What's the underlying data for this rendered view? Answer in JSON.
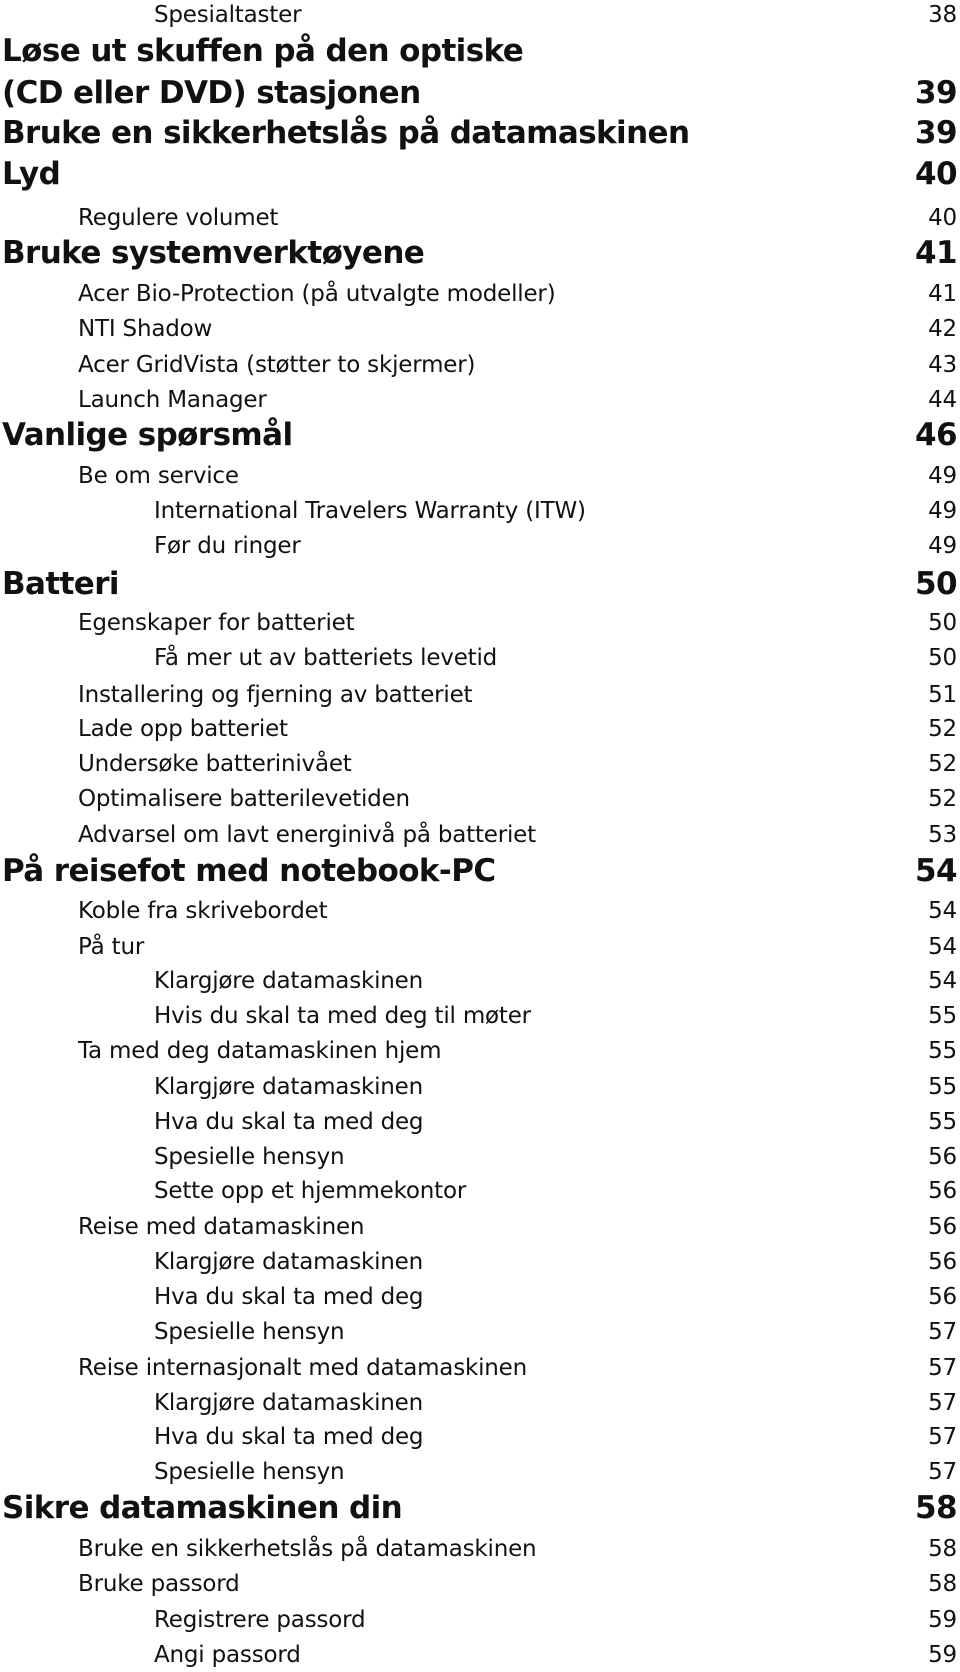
{
  "document": {
    "type": "table-of-contents",
    "entries": [
      {
        "level": 2,
        "title": "Spesialtaster",
        "page": "38"
      },
      {
        "level": 0,
        "title": "Løse ut skuffen på den optiske",
        "page": ""
      },
      {
        "level": 0,
        "title": "(CD eller DVD) stasjonen",
        "page": "39"
      },
      {
        "level": 0,
        "title": "Bruke en sikkerhetslås på datamaskinen",
        "page": "39"
      },
      {
        "level": 0,
        "title": "Lyd",
        "page": "40"
      },
      {
        "level": 1,
        "title": "Regulere volumet",
        "page": "40"
      },
      {
        "level": 0,
        "title": "Bruke systemverktøyene",
        "page": "41"
      },
      {
        "level": 1,
        "title": "Acer Bio-Protection (på utvalgte modeller)",
        "page": "41"
      },
      {
        "level": 1,
        "title": "NTI Shadow",
        "page": "42"
      },
      {
        "level": 1,
        "title": "Acer GridVista (støtter to skjermer)",
        "page": "43"
      },
      {
        "level": 1,
        "title": "Launch Manager",
        "page": "44"
      },
      {
        "level": 0,
        "title": "Vanlige spørsmål",
        "page": "46"
      },
      {
        "level": 1,
        "title": "Be om service",
        "page": "49"
      },
      {
        "level": 2,
        "title": "International Travelers Warranty (ITW)",
        "page": "49"
      },
      {
        "level": 2,
        "title": "Før du ringer",
        "page": "49"
      },
      {
        "level": 0,
        "title": "Batteri",
        "page": "50"
      },
      {
        "level": 1,
        "title": "Egenskaper for batteriet",
        "page": "50"
      },
      {
        "level": 2,
        "title": "Få mer ut av batteriets levetid",
        "page": "50"
      },
      {
        "level": 1,
        "title": "Installering og fjerning av batteriet",
        "page": "51"
      },
      {
        "level": 1,
        "title": "Lade opp batteriet",
        "page": "52"
      },
      {
        "level": 1,
        "title": "Undersøke batterinivået",
        "page": "52"
      },
      {
        "level": 1,
        "title": "Optimalisere batterilevetiden",
        "page": "52"
      },
      {
        "level": 1,
        "title": "Advarsel om lavt energinivå på batteriet",
        "page": "53"
      },
      {
        "level": 0,
        "title": "På reisefot med notebook-PC",
        "page": "54"
      },
      {
        "level": 1,
        "title": "Koble fra skrivebordet",
        "page": "54"
      },
      {
        "level": 1,
        "title": "På tur",
        "page": "54"
      },
      {
        "level": 2,
        "title": "Klargjøre datamaskinen",
        "page": "54"
      },
      {
        "level": 2,
        "title": "Hvis du skal ta med deg til møter",
        "page": "55"
      },
      {
        "level": 1,
        "title": "Ta med deg datamaskinen hjem",
        "page": "55"
      },
      {
        "level": 2,
        "title": "Klargjøre datamaskinen",
        "page": "55"
      },
      {
        "level": 2,
        "title": "Hva du skal ta med deg",
        "page": "55"
      },
      {
        "level": 2,
        "title": "Spesielle hensyn",
        "page": "56"
      },
      {
        "level": 2,
        "title": "Sette opp et hjemmekontor",
        "page": "56"
      },
      {
        "level": 1,
        "title": "Reise med datamaskinen",
        "page": "56"
      },
      {
        "level": 2,
        "title": "Klargjøre datamaskinen",
        "page": "56"
      },
      {
        "level": 2,
        "title": "Hva du skal ta med deg",
        "page": "56"
      },
      {
        "level": 2,
        "title": "Spesielle hensyn",
        "page": "57"
      },
      {
        "level": 1,
        "title": "Reise internasjonalt med datamaskinen",
        "page": "57"
      },
      {
        "level": 2,
        "title": "Klargjøre datamaskinen",
        "page": "57"
      },
      {
        "level": 2,
        "title": "Hva du skal ta med deg",
        "page": "57"
      },
      {
        "level": 2,
        "title": "Spesielle hensyn",
        "page": "57"
      },
      {
        "level": 0,
        "title": "Sikre datamaskinen din",
        "page": "58"
      },
      {
        "level": 1,
        "title": "Bruke en sikkerhetslås på datamaskinen",
        "page": "58"
      },
      {
        "level": 1,
        "title": "Bruke passord",
        "page": "58"
      },
      {
        "level": 2,
        "title": "Registrere passord",
        "page": "59"
      },
      {
        "level": 2,
        "title": "Angi passord",
        "page": "59"
      }
    ]
  }
}
